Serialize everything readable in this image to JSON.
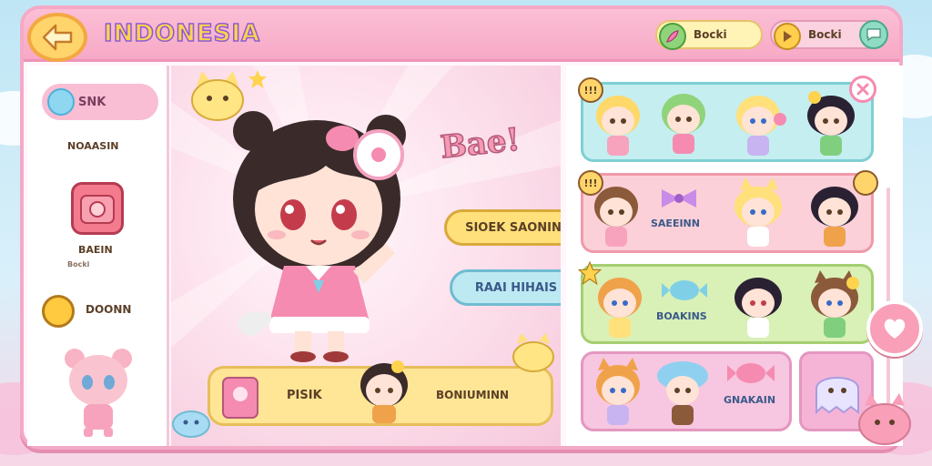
{
  "header": {
    "title": "INDONESIA",
    "pill_1_label": "Bocki",
    "pill_2_label": "Bocki"
  },
  "sidebar": {
    "active_item_label": "SNK",
    "item_1_label": "NOAASIN",
    "item_2_label": "BAEIN",
    "item_2_sub": "Bocki",
    "item_3_label": "DOONN"
  },
  "center": {
    "banner_text": "Bae!",
    "button_1_label": "SIOEK SAONIN",
    "button_2_label": "RAAI HIHAIS",
    "bottom_label_1": "PISIK",
    "bottom_label_2": "BONIUMINN"
  },
  "right_panel": {
    "row_1_badge": "!!!",
    "row_2_badge": "!!!",
    "row_2_label": "SAEEINN",
    "row_3_label": "BOAKINS",
    "row_4_label": "GNAKAIN"
  },
  "colors": {
    "frame_border": "#f4a9c6",
    "header_bg": "#f7a9c6",
    "title_fill": "#ffd34d",
    "row_blue": "#bdeef0",
    "row_pink": "#fbcfd8",
    "row_green": "#d7f0b4",
    "row_lilac": "#f7c6e0"
  },
  "icons": [
    "back-arrow-icon",
    "feather-icon",
    "play-icon",
    "chat-icon",
    "sparkle-icon",
    "close-icon",
    "star-icon",
    "heart-icon"
  ]
}
